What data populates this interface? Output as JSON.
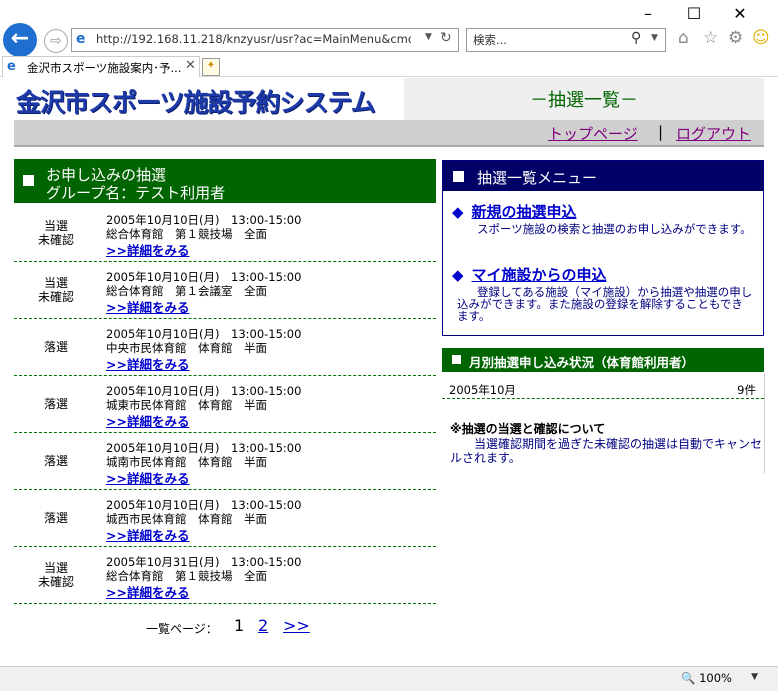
{
  "browser": {
    "url": "http://192.168.11.218/knzyusr/usr?ac=MainMenu&cmd=Lot&",
    "search_placeholder": "検索...",
    "tab_title": "金沢市スポーツ施設案内･予...",
    "zoom": "100%",
    "icons": [
      "back-icon",
      "forward-icon",
      "refresh-icon",
      "search-icon",
      "home-icon",
      "favorites-icon",
      "settings-icon",
      "smiley-icon"
    ]
  },
  "header": {
    "logo_text": "金沢市スポーツ施設予約システム",
    "page_heading": "－抽選一覧－",
    "nav": {
      "top_page": "トップページ",
      "separator": "|",
      "logout": "ログアウト"
    }
  },
  "left": {
    "heading_line1": "お申し込みの抽選",
    "heading_line2": "グループ名：テスト利用者",
    "detail_label": ">>詳細をみる",
    "rows": [
      {
        "status": [
          "当選",
          "未確認"
        ],
        "datetime": "2005年10月10日(月)　13:00-15:00",
        "place": "総合体育館　第１競技場　全面"
      },
      {
        "status": [
          "当選",
          "未確認"
        ],
        "datetime": "2005年10月10日(月)　13:00-15:00",
        "place": "総合体育館　第１会議室　全面"
      },
      {
        "status": [
          "落選"
        ],
        "datetime": "2005年10月10日(月)　13:00-15:00",
        "place": "中央市民体育館　体育館　半面"
      },
      {
        "status": [
          "落選"
        ],
        "datetime": "2005年10月10日(月)　13:00-15:00",
        "place": "城東市民体育館　体育館　半面"
      },
      {
        "status": [
          "落選"
        ],
        "datetime": "2005年10月10日(月)　13:00-15:00",
        "place": "城南市民体育館　体育館　半面"
      },
      {
        "status": [
          "落選"
        ],
        "datetime": "2005年10月10日(月)　13:00-15:00",
        "place": "城西市民体育館　体育館　半面"
      },
      {
        "status": [
          "当選",
          "未確認"
        ],
        "datetime": "2005年10月31日(月)　13:00-15:00",
        "place": "総合体育館　第１競技場　全面"
      }
    ],
    "pager": {
      "label": "一覧ページ：",
      "current": "1",
      "page2": "2",
      "next": ">>"
    }
  },
  "right": {
    "menu_title": "抽選一覧メニュー",
    "menu_items": [
      {
        "marker": "◆",
        "title": "新規の抽選申込",
        "desc": "スポーツ施設の検索と抽選のお申し込みができます。"
      },
      {
        "marker": "◆",
        "title": "マイ施設からの申込",
        "desc": "登録してある施設（マイ施設）から抽選や抽選の申し込みができます。また施設の登録を解除することもできます。"
      }
    ],
    "status_title": "月別抽選申し込み状況（体育館利用者）",
    "status_rows": [
      {
        "month": "2005年10月",
        "count": "9件"
      }
    ],
    "note_title": "※抽選の当選と確認について",
    "note_body": "当選確認期間を過ぎた未確認の抽選は自動でキャンセルされます。"
  },
  "colors": {
    "green": "#006400",
    "navy": "#000066",
    "link": "#0000cc",
    "visited": "#800080",
    "logo": "#1e3aa8"
  }
}
